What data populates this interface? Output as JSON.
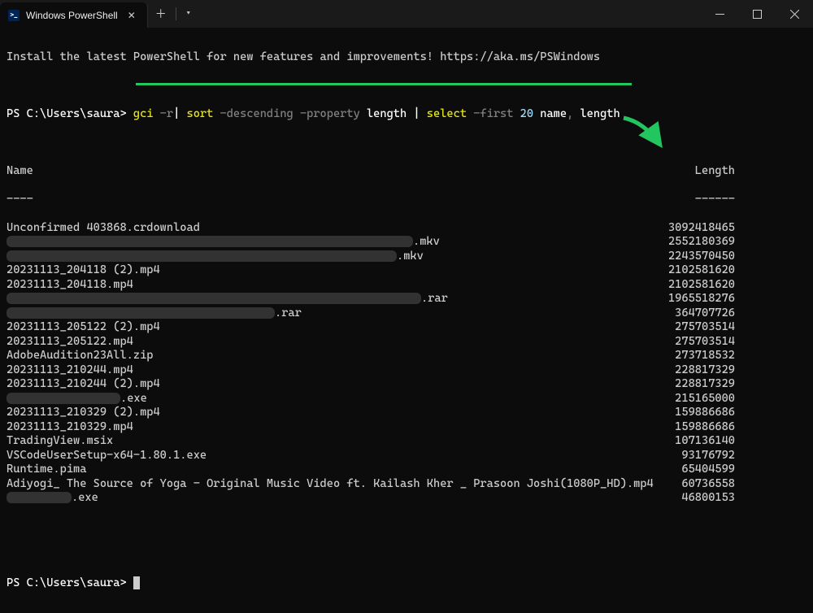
{
  "titlebar": {
    "tab_title": "Windows PowerShell",
    "tab_icon_char": ">_"
  },
  "banner": "Install the latest PowerShell for new features and improvements! https://aka.ms/PSWindows",
  "prompt": {
    "prefix": "PS C:\\Users\\saura> ",
    "cmd1": "gci",
    "flag1": " -r",
    "pipe1": "| ",
    "cmd2": "sort",
    "flag2": " -descending -property",
    "arg2": " length ",
    "pipe2": "| ",
    "cmd3": "select",
    "flag3": " -first",
    "arg3_num": " 20",
    "arg3_rest": " name",
    "comma": ",",
    "arg4": " length"
  },
  "headers": {
    "name": "Name",
    "length": "Length"
  },
  "dividers": {
    "name": "----",
    "length": "------"
  },
  "rows": [
    {
      "name": "Unconfirmed 403868.crdownload",
      "redact_w": 0,
      "suffix": "",
      "length": "3092418465"
    },
    {
      "name": "",
      "redact_w": 500,
      "suffix": ".mkv",
      "length": "2552180369"
    },
    {
      "name": "",
      "redact_w": 480,
      "suffix": ".mkv",
      "length": "2243570450"
    },
    {
      "name": "20231113_204118 (2).mp4",
      "redact_w": 0,
      "suffix": "",
      "length": "2102581620"
    },
    {
      "name": "20231113_204118.mp4",
      "redact_w": 0,
      "suffix": "",
      "length": "2102581620"
    },
    {
      "name": "",
      "redact_w": 510,
      "suffix": ".rar",
      "length": "1965518276"
    },
    {
      "name": "",
      "redact_w": 330,
      "suffix": ".rar",
      "length": "364707726"
    },
    {
      "name": "20231113_205122 (2).mp4",
      "redact_w": 0,
      "suffix": "",
      "length": "275703514"
    },
    {
      "name": "20231113_205122.mp4",
      "redact_w": 0,
      "suffix": "",
      "length": "275703514"
    },
    {
      "name": "AdobeAudition23All.zip",
      "redact_w": 0,
      "suffix": "",
      "length": "273718532"
    },
    {
      "name": "20231113_210244.mp4",
      "redact_w": 0,
      "suffix": "",
      "length": "228817329"
    },
    {
      "name": "20231113_210244 (2).mp4",
      "redact_w": 0,
      "suffix": "",
      "length": "228817329"
    },
    {
      "name": "",
      "redact_w": 140,
      "suffix": ".exe",
      "length": "215165000"
    },
    {
      "name": "20231113_210329 (2).mp4",
      "redact_w": 0,
      "suffix": "",
      "length": "159886686"
    },
    {
      "name": "20231113_210329.mp4",
      "redact_w": 0,
      "suffix": "",
      "length": "159886686"
    },
    {
      "name": "TradingView.msix",
      "redact_w": 0,
      "suffix": "",
      "length": "107136140"
    },
    {
      "name": "VSCodeUserSetup-x64-1.80.1.exe",
      "redact_w": 0,
      "suffix": "",
      "length": "93176792"
    },
    {
      "name": "Runtime.pima",
      "redact_w": 0,
      "suffix": "",
      "length": "65404599"
    },
    {
      "name": "Adiyogi_ The Source of Yoga - Original Music Video ft. Kailash Kher _ Prasoon Joshi(1080P_HD).mp4",
      "redact_w": 0,
      "suffix": "",
      "length": "60736558"
    },
    {
      "name": "",
      "redact_w": 80,
      "suffix": ".exe",
      "length": "46800153"
    }
  ],
  "prompt2": "PS C:\\Users\\saura> "
}
